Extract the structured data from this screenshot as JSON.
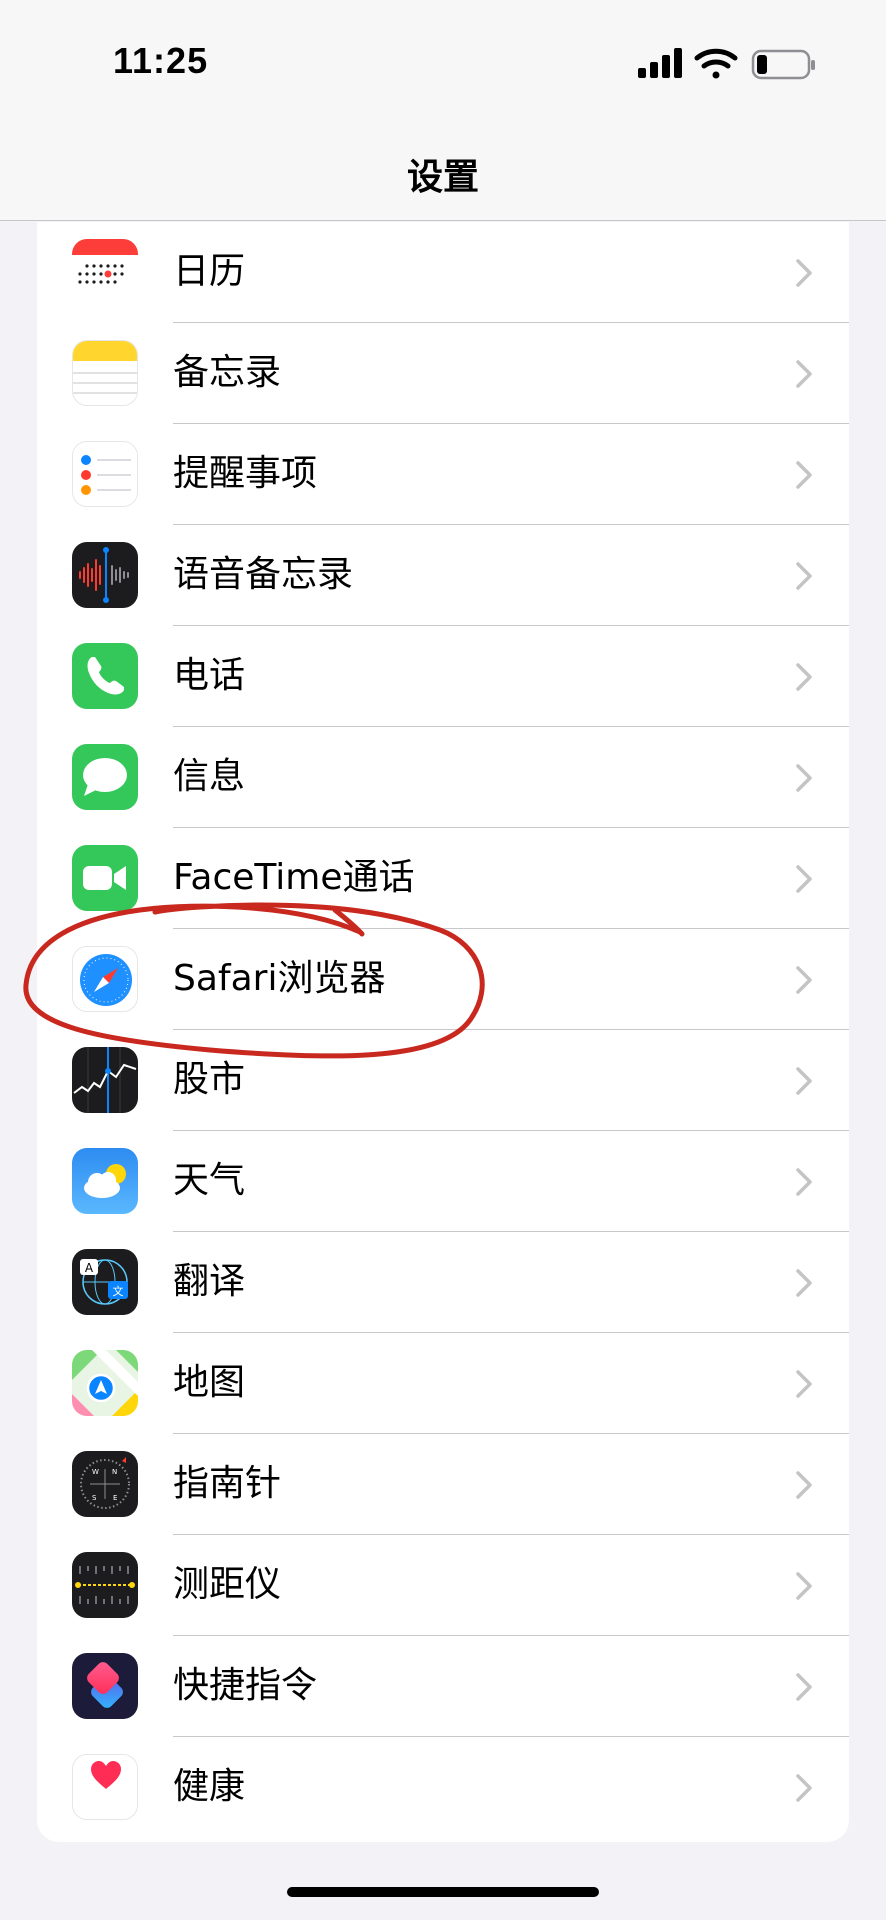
{
  "status_bar": {
    "time": "11:25",
    "icons": [
      "cellular-signal-icon",
      "wifi-icon",
      "battery-icon"
    ]
  },
  "nav": {
    "title": "设置"
  },
  "settings_items": [
    {
      "label": "日历",
      "icon": "calendar-icon"
    },
    {
      "label": "备忘录",
      "icon": "notes-icon"
    },
    {
      "label": "提醒事项",
      "icon": "reminders-icon"
    },
    {
      "label": "语音备忘录",
      "icon": "voice-memos-icon"
    },
    {
      "label": "电话",
      "icon": "phone-icon"
    },
    {
      "label": "信息",
      "icon": "messages-icon"
    },
    {
      "label": "FaceTime通话",
      "icon": "facetime-icon"
    },
    {
      "label": "Safari浏览器",
      "icon": "safari-icon"
    },
    {
      "label": "股市",
      "icon": "stocks-icon"
    },
    {
      "label": "天气",
      "icon": "weather-icon"
    },
    {
      "label": "翻译",
      "icon": "translate-icon"
    },
    {
      "label": "地图",
      "icon": "maps-icon"
    },
    {
      "label": "指南针",
      "icon": "compass-icon"
    },
    {
      "label": "测距仪",
      "icon": "measure-icon"
    },
    {
      "label": "快捷指令",
      "icon": "shortcuts-icon"
    },
    {
      "label": "健康",
      "icon": "health-icon"
    }
  ],
  "annotation": {
    "type": "hand-drawn-circle",
    "target": "Safari浏览器",
    "color": "#c8281e"
  },
  "colors": {
    "background": "#f2f2f7",
    "chevron": "#c4c4c7",
    "separator": "#c8c8cc"
  }
}
